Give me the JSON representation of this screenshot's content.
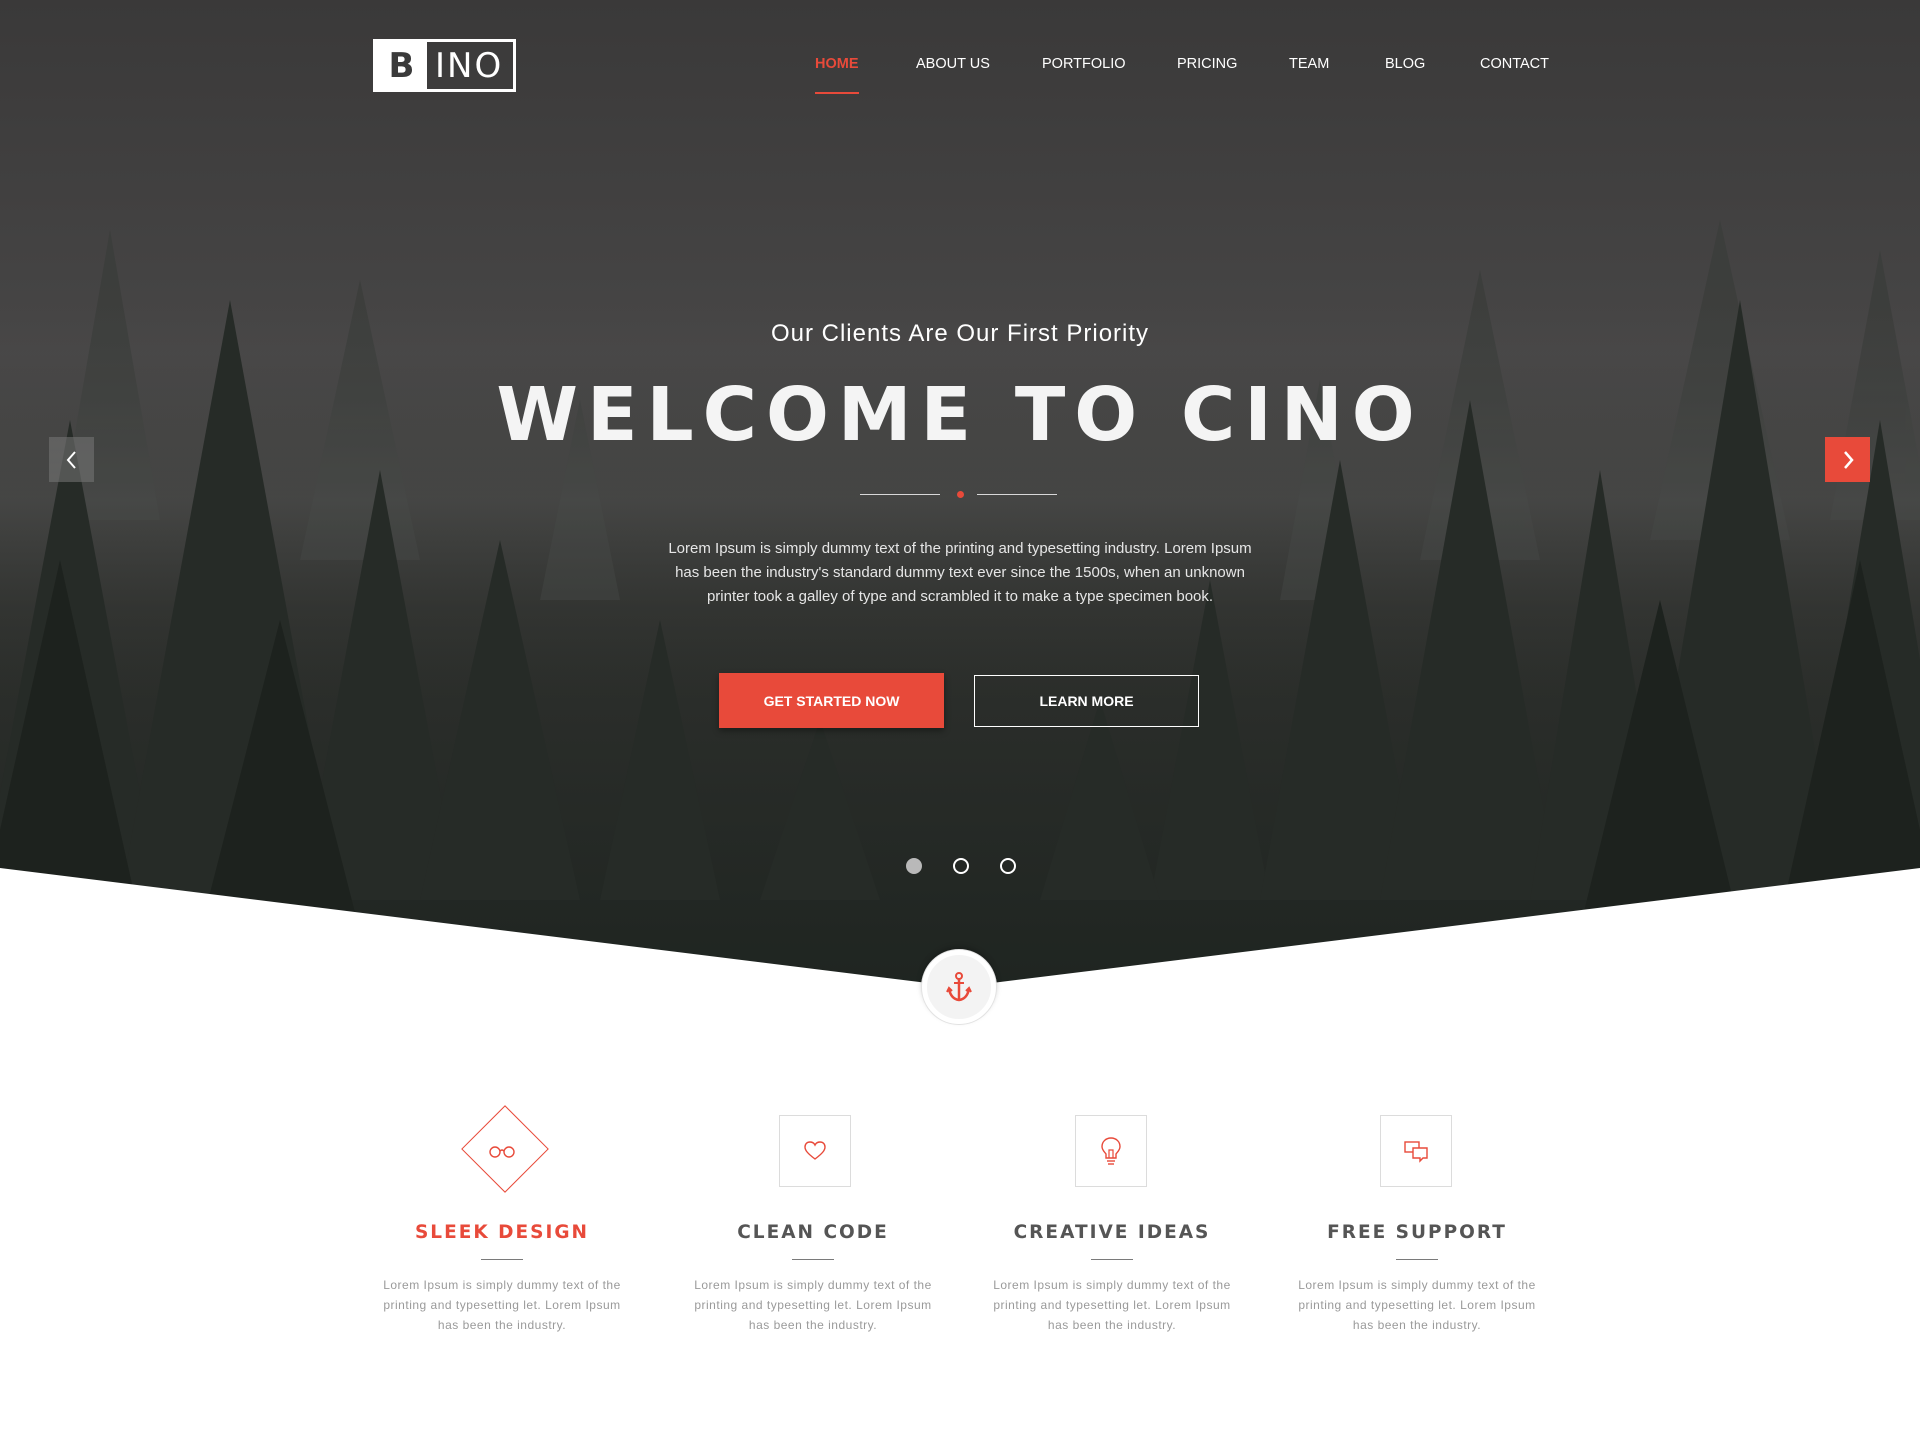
{
  "brand": {
    "logo_letter": "B",
    "logo_rest": "INO",
    "accent_color": "#e84a3a"
  },
  "nav": {
    "items": [
      {
        "label": "HOME",
        "active": true
      },
      {
        "label": "ABOUT US",
        "active": false
      },
      {
        "label": "PORTFOLIO",
        "active": false
      },
      {
        "label": "PRICING",
        "active": false
      },
      {
        "label": "TEAM",
        "active": false
      },
      {
        "label": "BLOG",
        "active": false
      },
      {
        "label": "CONTACT",
        "active": false
      }
    ]
  },
  "hero": {
    "subtitle": "Our Clients Are Our First Priority",
    "title": "WELCOME TO CINO",
    "text": "Lorem Ipsum is simply dummy text of the printing and typesetting industry. Lorem Ipsum has been the industry's standard dummy text ever since the 1500s, when an unknown printer took a galley of type and scrambled it to make a type specimen book.",
    "primary_button": "GET STARTED NOW",
    "secondary_button": "LEARN MORE",
    "prev_icon": "chevron-left-icon",
    "next_icon": "chevron-right-icon",
    "slides_count": 3,
    "active_slide": 1
  },
  "anchor": {
    "icon": "anchor-icon"
  },
  "features": [
    {
      "title": "SLEEK DESIGN",
      "icon": "glasses-icon",
      "text": "Lorem Ipsum is simply dummy text of the printing and typesetting let. Lorem Ipsum has been the industry.",
      "highlight": true
    },
    {
      "title": "CLEAN CODE",
      "icon": "heart-icon",
      "text": "Lorem Ipsum is simply dummy text of the printing and typesetting let. Lorem Ipsum has been the industry.",
      "highlight": false
    },
    {
      "title": "CREATIVE IDEAS",
      "icon": "lightbulb-icon",
      "text": "Lorem Ipsum is simply dummy text of the printing and typesetting let. Lorem Ipsum has been the industry.",
      "highlight": false
    },
    {
      "title": "FREE SUPPORT",
      "icon": "chat-icon",
      "text": "Lorem Ipsum is simply dummy text of the printing and typesetting let. Lorem Ipsum has been the industry.",
      "highlight": false
    }
  ]
}
